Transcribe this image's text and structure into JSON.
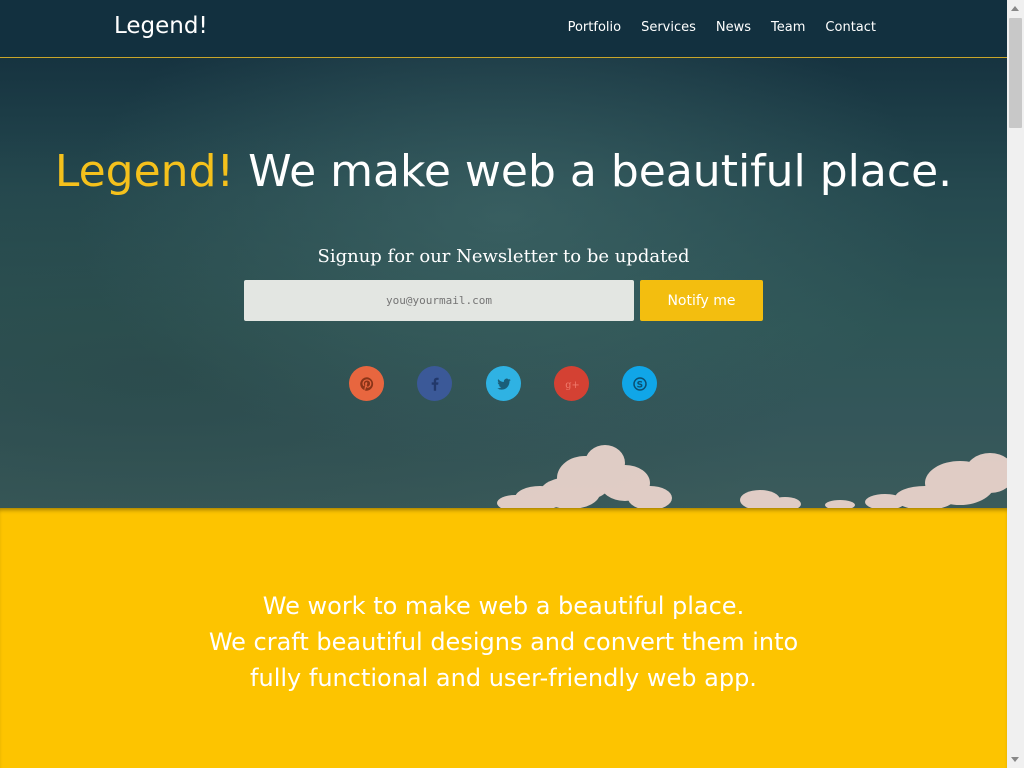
{
  "nav": {
    "brand": "Legend!",
    "links": [
      "Portfolio",
      "Services",
      "News",
      "Team",
      "Contact"
    ]
  },
  "hero": {
    "title_accent": "Legend!",
    "title_rest": "We make web a beautiful place.",
    "subtitle": "Signup for our Newsletter to be updated",
    "email_placeholder": "you@yourmail.com",
    "notify_label": "Notify me",
    "social": [
      {
        "name": "pinterest-icon",
        "color": "#e8663f"
      },
      {
        "name": "facebook-icon",
        "color": "#3b5998"
      },
      {
        "name": "twitter-icon",
        "color": "#2fb2e3"
      },
      {
        "name": "google-plus-icon",
        "color": "#d44133"
      },
      {
        "name": "skype-icon",
        "color": "#10a6e8"
      }
    ]
  },
  "about": {
    "lines": [
      "We work to make web a beautiful place.",
      "We craft beautiful designs and convert them into",
      "fully functional and user-friendly web app."
    ]
  },
  "colors": {
    "accent": "#f5c11c",
    "nav_bg": "#12303f",
    "section_bg": "#fdc400"
  }
}
